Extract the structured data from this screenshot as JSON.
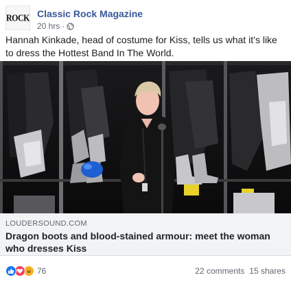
{
  "post": {
    "page_name": "Classic Rock Magazine",
    "avatar_text": "ROCK",
    "time": "20 hrs",
    "separator": "·",
    "privacy_icon": "globe-icon",
    "text": "Hannah Kinkade, head of costume for Kiss, tells us what it’s like to dress the Hottest Band In The World."
  },
  "link": {
    "domain": "LOUDERSOUND.COM",
    "title": "Dragon boots and blood-stained armour: meet the woman who dresses Kiss"
  },
  "footer": {
    "reaction_icons": [
      "like-icon",
      "love-icon",
      "haha-icon"
    ],
    "reaction_count": "76",
    "comments": "22 comments",
    "shares": "15 shares"
  },
  "colors": {
    "page_name": "#385898",
    "like": "#1877f2",
    "love": "#f33e58",
    "haha": "#f7b125",
    "link_bg": "#f2f3f5"
  }
}
